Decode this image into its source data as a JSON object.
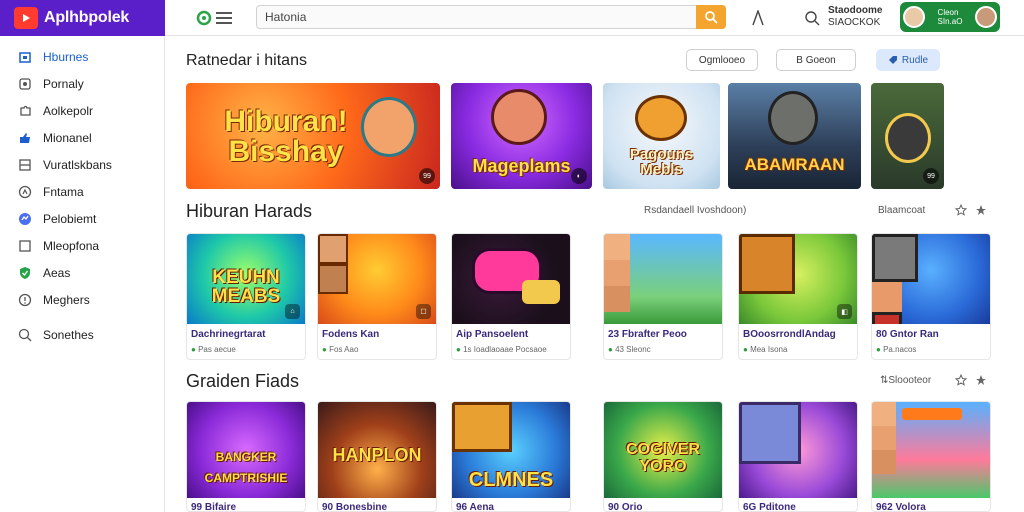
{
  "brand": {
    "name": "Aplhbpolek"
  },
  "search": {
    "value": "Hatonia"
  },
  "account": {
    "line1": "Staodoome",
    "line2": "SIAOCKOK",
    "badge_line1": "Cleon",
    "badge_line2": "SIn.aO"
  },
  "sidebar": {
    "items": [
      {
        "label": "Hburnes",
        "icon": "home-icon",
        "active": true
      },
      {
        "label": "Pornaly",
        "icon": "bookmark-icon",
        "active": false
      },
      {
        "label": "Aolkepolr",
        "icon": "puzzle-icon",
        "active": false
      },
      {
        "label": "Mionanel",
        "icon": "thumbs-up-icon",
        "active": false
      },
      {
        "label": "Vuratlskbans",
        "icon": "grid-icon",
        "active": false
      },
      {
        "label": "Fntama",
        "icon": "compass-icon",
        "active": false
      },
      {
        "label": "Pelobiemt",
        "icon": "discord-icon",
        "active": false
      },
      {
        "label": "Mleopfona",
        "icon": "square-icon",
        "active": false
      },
      {
        "label": "Aeas",
        "icon": "shield-check-icon",
        "active": false
      },
      {
        "label": "Meghers",
        "icon": "info-icon",
        "active": false
      }
    ],
    "footer_item": {
      "label": "Sonethes",
      "icon": "search-icon"
    }
  },
  "section1": {
    "title": "Ratnedar i hitans",
    "filters": [
      "Ogmlooeo",
      "B Goeon",
      "Rudle"
    ],
    "tiles": [
      {
        "title": "Hiburan! Bisshay",
        "badge": "99"
      },
      {
        "title": "Mageplams",
        "badge": ""
      },
      {
        "title": "Pagouns Mebls",
        "badge": ""
      },
      {
        "title": "ABAMRAAN",
        "badge": ""
      },
      {
        "title": "",
        "badge": "99"
      }
    ]
  },
  "section2": {
    "title": "Hiburan Harads",
    "subtitle": "Rsdandaell Ivoshdoon)",
    "side_label": "Blaamcoat",
    "cards": [
      {
        "thumb_title": "KEUHN MEABS",
        "title": "Dachrinegrtarat",
        "meta": "Pas aecue"
      },
      {
        "title": "Fodens Kan",
        "meta": "Fos Aao"
      },
      {
        "title": "Aip Pansoelent",
        "meta": "1s Ioadlaoaae Pocsaoe"
      },
      {
        "title": "23 Fbrafter Peoo",
        "meta": "43 Sleonc"
      },
      {
        "title": "BOoosrrondlAndag",
        "meta": "Mea Isona"
      },
      {
        "title": "80 Gntor Ran",
        "meta": "Pa.nacos"
      }
    ]
  },
  "section3": {
    "title": "Graiden Fiads",
    "side_label": "Sloooteor",
    "cards": [
      {
        "thumb_title": "BANGKER CAMPTRISHIE",
        "title": "99 Bifaire"
      },
      {
        "thumb_title": "HANPLON",
        "title": "90 Bonesbine"
      },
      {
        "thumb_title": "CLMNES",
        "title": "96 Aena"
      },
      {
        "thumb_title": "COGIVER YORO",
        "title": "90 Orio"
      },
      {
        "thumb_title": "",
        "title": "6G Pditone"
      },
      {
        "thumb_title": "",
        "title": "962 Volora"
      }
    ]
  }
}
